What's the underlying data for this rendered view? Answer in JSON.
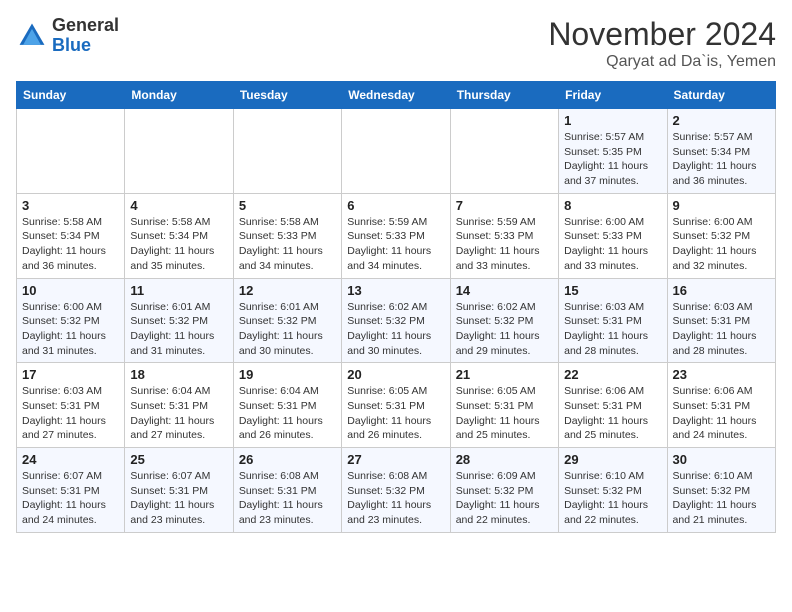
{
  "header": {
    "logo_line1": "General",
    "logo_line2": "Blue",
    "title": "November 2024",
    "subtitle": "Qaryat ad Da`is, Yemen"
  },
  "days_of_week": [
    "Sunday",
    "Monday",
    "Tuesday",
    "Wednesday",
    "Thursday",
    "Friday",
    "Saturday"
  ],
  "weeks": [
    [
      {
        "day": "",
        "detail": ""
      },
      {
        "day": "",
        "detail": ""
      },
      {
        "day": "",
        "detail": ""
      },
      {
        "day": "",
        "detail": ""
      },
      {
        "day": "",
        "detail": ""
      },
      {
        "day": "1",
        "detail": "Sunrise: 5:57 AM\nSunset: 5:35 PM\nDaylight: 11 hours and 37 minutes."
      },
      {
        "day": "2",
        "detail": "Sunrise: 5:57 AM\nSunset: 5:34 PM\nDaylight: 11 hours and 36 minutes."
      }
    ],
    [
      {
        "day": "3",
        "detail": "Sunrise: 5:58 AM\nSunset: 5:34 PM\nDaylight: 11 hours and 36 minutes."
      },
      {
        "day": "4",
        "detail": "Sunrise: 5:58 AM\nSunset: 5:34 PM\nDaylight: 11 hours and 35 minutes."
      },
      {
        "day": "5",
        "detail": "Sunrise: 5:58 AM\nSunset: 5:33 PM\nDaylight: 11 hours and 34 minutes."
      },
      {
        "day": "6",
        "detail": "Sunrise: 5:59 AM\nSunset: 5:33 PM\nDaylight: 11 hours and 34 minutes."
      },
      {
        "day": "7",
        "detail": "Sunrise: 5:59 AM\nSunset: 5:33 PM\nDaylight: 11 hours and 33 minutes."
      },
      {
        "day": "8",
        "detail": "Sunrise: 6:00 AM\nSunset: 5:33 PM\nDaylight: 11 hours and 33 minutes."
      },
      {
        "day": "9",
        "detail": "Sunrise: 6:00 AM\nSunset: 5:32 PM\nDaylight: 11 hours and 32 minutes."
      }
    ],
    [
      {
        "day": "10",
        "detail": "Sunrise: 6:00 AM\nSunset: 5:32 PM\nDaylight: 11 hours and 31 minutes."
      },
      {
        "day": "11",
        "detail": "Sunrise: 6:01 AM\nSunset: 5:32 PM\nDaylight: 11 hours and 31 minutes."
      },
      {
        "day": "12",
        "detail": "Sunrise: 6:01 AM\nSunset: 5:32 PM\nDaylight: 11 hours and 30 minutes."
      },
      {
        "day": "13",
        "detail": "Sunrise: 6:02 AM\nSunset: 5:32 PM\nDaylight: 11 hours and 30 minutes."
      },
      {
        "day": "14",
        "detail": "Sunrise: 6:02 AM\nSunset: 5:32 PM\nDaylight: 11 hours and 29 minutes."
      },
      {
        "day": "15",
        "detail": "Sunrise: 6:03 AM\nSunset: 5:31 PM\nDaylight: 11 hours and 28 minutes."
      },
      {
        "day": "16",
        "detail": "Sunrise: 6:03 AM\nSunset: 5:31 PM\nDaylight: 11 hours and 28 minutes."
      }
    ],
    [
      {
        "day": "17",
        "detail": "Sunrise: 6:03 AM\nSunset: 5:31 PM\nDaylight: 11 hours and 27 minutes."
      },
      {
        "day": "18",
        "detail": "Sunrise: 6:04 AM\nSunset: 5:31 PM\nDaylight: 11 hours and 27 minutes."
      },
      {
        "day": "19",
        "detail": "Sunrise: 6:04 AM\nSunset: 5:31 PM\nDaylight: 11 hours and 26 minutes."
      },
      {
        "day": "20",
        "detail": "Sunrise: 6:05 AM\nSunset: 5:31 PM\nDaylight: 11 hours and 26 minutes."
      },
      {
        "day": "21",
        "detail": "Sunrise: 6:05 AM\nSunset: 5:31 PM\nDaylight: 11 hours and 25 minutes."
      },
      {
        "day": "22",
        "detail": "Sunrise: 6:06 AM\nSunset: 5:31 PM\nDaylight: 11 hours and 25 minutes."
      },
      {
        "day": "23",
        "detail": "Sunrise: 6:06 AM\nSunset: 5:31 PM\nDaylight: 11 hours and 24 minutes."
      }
    ],
    [
      {
        "day": "24",
        "detail": "Sunrise: 6:07 AM\nSunset: 5:31 PM\nDaylight: 11 hours and 24 minutes."
      },
      {
        "day": "25",
        "detail": "Sunrise: 6:07 AM\nSunset: 5:31 PM\nDaylight: 11 hours and 23 minutes."
      },
      {
        "day": "26",
        "detail": "Sunrise: 6:08 AM\nSunset: 5:31 PM\nDaylight: 11 hours and 23 minutes."
      },
      {
        "day": "27",
        "detail": "Sunrise: 6:08 AM\nSunset: 5:32 PM\nDaylight: 11 hours and 23 minutes."
      },
      {
        "day": "28",
        "detail": "Sunrise: 6:09 AM\nSunset: 5:32 PM\nDaylight: 11 hours and 22 minutes."
      },
      {
        "day": "29",
        "detail": "Sunrise: 6:10 AM\nSunset: 5:32 PM\nDaylight: 11 hours and 22 minutes."
      },
      {
        "day": "30",
        "detail": "Sunrise: 6:10 AM\nSunset: 5:32 PM\nDaylight: 11 hours and 21 minutes."
      }
    ]
  ]
}
